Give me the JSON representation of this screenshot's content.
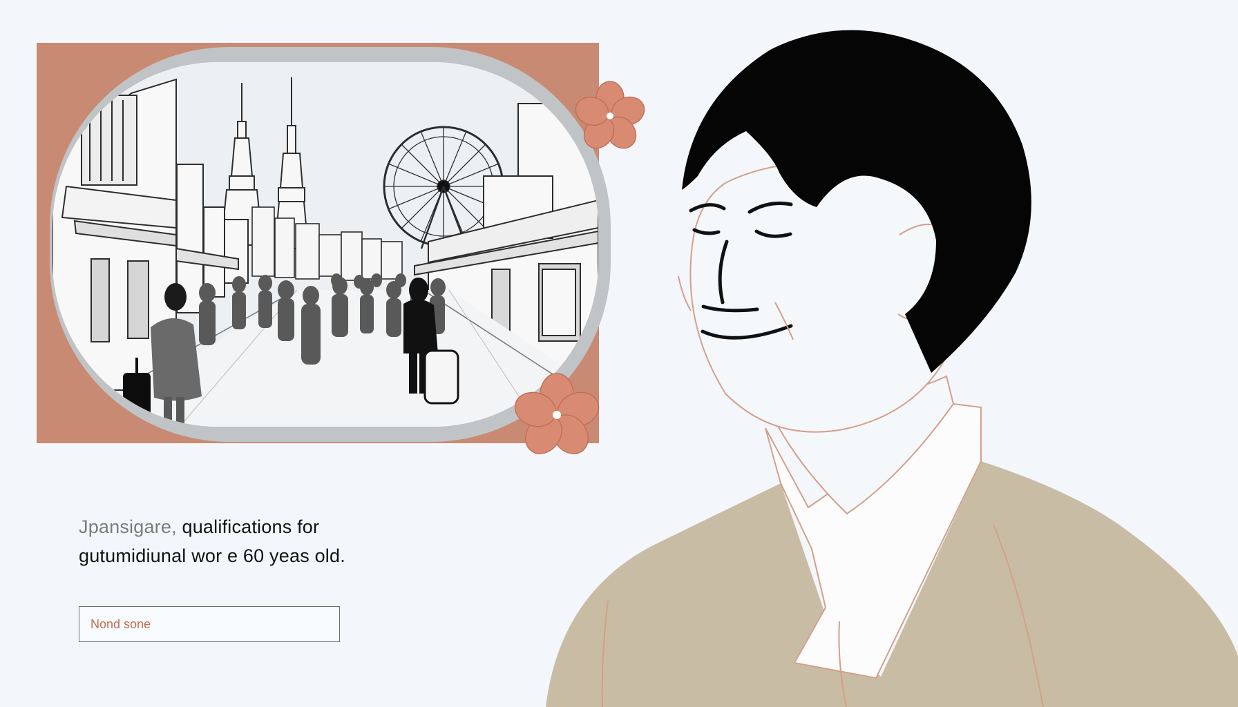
{
  "caption": {
    "lead": "Jpansigare,",
    "line1_rest": " qualifications for",
    "line2": "gutumidiunal wor e 60 yeas old."
  },
  "name_field": {
    "placeholder": "Nond sone"
  },
  "colors": {
    "background": "#f3f7fb",
    "accent": "#c98a73",
    "blossom": "#d88b72",
    "sweater": "#c8bda4",
    "hair": "#050505",
    "frame_ring": "#bfc2c4"
  },
  "icons": {
    "blossom_top": "sakura-blossom-icon",
    "blossom_bottom": "sakura-blossom-icon"
  }
}
